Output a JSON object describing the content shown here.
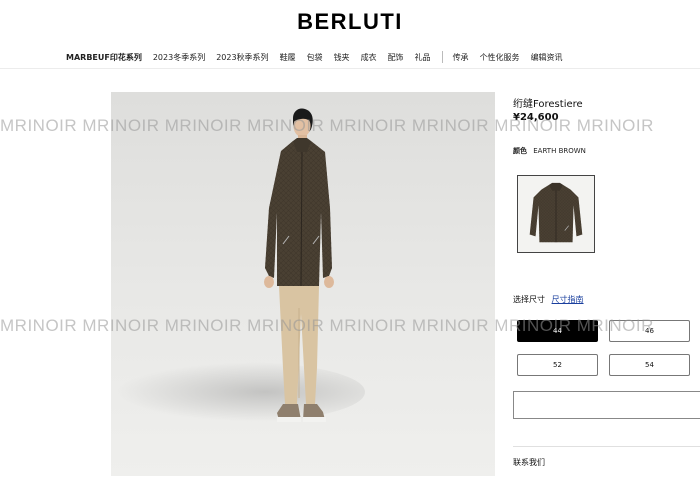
{
  "brand": {
    "logo": "BERLUTI"
  },
  "nav": {
    "items": [
      "MARBEUF印花系列",
      "2023冬季系列",
      "2023秋季系列",
      "鞋履",
      "包袋",
      "钱夹",
      "成衣",
      "配饰",
      "礼品"
    ],
    "items_after_separator": [
      "传承",
      "个性化服务",
      "编辑资讯"
    ]
  },
  "product": {
    "title": "绗缝Forestiere",
    "price": "¥24,600",
    "color_label": "颜色",
    "color_value": "EARTH BROWN",
    "size_label": "选择尺寸",
    "size_guide": "尺寸指南",
    "sizes": [
      "44",
      "46",
      "52",
      "54"
    ],
    "selected_size": "44",
    "contact": "联系我们"
  },
  "watermark": {
    "text": "MRINOIR MRINOIR MRINOIR MRINOIR MRINOIR MRINOIR MRINOIR MRINOIR"
  },
  "colors": {
    "jacket": "#4a4033",
    "trousers": "#d9c4a2",
    "accent_link": "#1a3f9e",
    "selected_size_bg": "#000000"
  }
}
